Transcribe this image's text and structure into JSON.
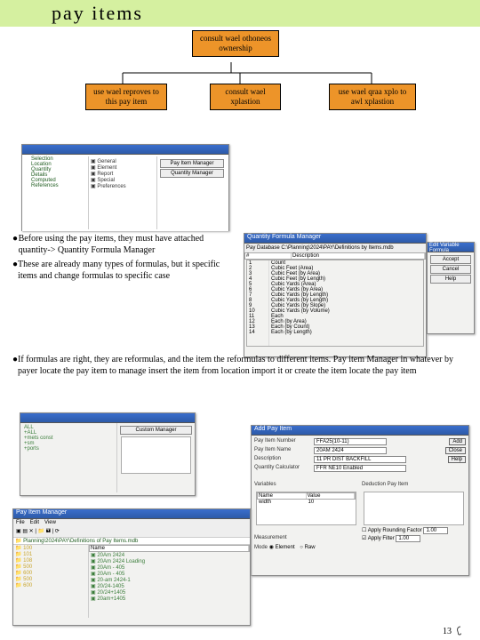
{
  "title": "pay items",
  "org": {
    "top": "consult wael othoneos ownership",
    "l": "use wael reproves to this pay item",
    "m": "consult wael xplastion",
    "r": "use wael qraa xplo to awl xplastion"
  },
  "bullets": [
    "Before using the pay items, they must have attached quantity-> Quantity Formula Manager",
    "These are already many types of formulas, but it specific items and change formulas to specific case",
    "If formulas are right, they are reformulas, and the item the reformulas to different items. Pay item Manager in whatever by payer locate the pay item to manage insert the item from location import it or create the item locate the pay item"
  ],
  "shots": {
    "a_tree": [
      "Selection",
      "Location",
      "Quantity",
      "Details",
      "Computed",
      "References"
    ],
    "a_btns": [
      "Pay Item Manager",
      "Quantity Manager"
    ],
    "b_title": "Quantity Formula Manager",
    "b_path": "Pay Database   C:\\Planning\\2024\\PAY\\Definitions by Items.mdb",
    "b_list": [
      "1",
      "2",
      "3",
      "4",
      "5",
      "6",
      "7",
      "8",
      "9",
      "10",
      "11",
      "12",
      "13",
      "14"
    ],
    "b_desc": [
      "Count",
      "Cubic Feet (Area)",
      "Cubic Feet (by Area)",
      "Cubic Feet (by Length)",
      "Cubic Yards (Area)",
      "Cubic Yards (by Area)",
      "Cubic Yards (by Length)",
      "Cubic Yards (by Length)",
      "Cubic Yards (by Slope)",
      "Cubic Yards (by Volume)",
      "Each",
      "Each (by Area)",
      "Each (by Count)",
      "Each (by Length)"
    ],
    "c_title": "Edit Variable Formula",
    "c_btns": [
      "Accept",
      "Cancel",
      "Help"
    ],
    "d_items": [
      "ALL",
      "+ALL",
      "+mets const",
      "+sm",
      "+ports"
    ],
    "d_btn": "Custom Manager",
    "e_title": "Add Pay Item",
    "e_num_lbl": "Pay Item Number",
    "e_num": "FFA25(10-11)",
    "e_name_lbl": "Pay Item Name",
    "e_name": "20AM 2424",
    "e_desc_lbl": "Description",
    "e_desc": "11 PR DIST BACKFILL",
    "e_q_lbl": "Quantity Calculator",
    "e_q": "FFR NE10 Enabled",
    "e_var_lbl": "Variables",
    "e_n": "Name",
    "e_v": "Value",
    "e_nrow": "width",
    "e_vrow": "10",
    "e_meas_lbl": "Measurement",
    "e_mode_lbl": "Mode",
    "e_radio1": "Element",
    "e_radio2": "Raw",
    "e_dp_lbl": "Deduction Pay Item",
    "e_ah": "Apply Rounding Factor",
    "e_ahv": "1.00",
    "e_af": "Apply Filter",
    "e_afv": "1.00",
    "e_add": "Add",
    "e_close": "Close",
    "e_help": "Help",
    "f_title": "Pay Item Manager",
    "f_menu": [
      "File",
      "Edit",
      "View"
    ],
    "f_path": "Planning\\2024\\PAY\\Definitions of Pay Items.mdb",
    "f_cols": [
      "Name"
    ],
    "f_folders": [
      "100",
      "101",
      "108",
      "500",
      "600",
      "500",
      "600"
    ],
    "f_items": [
      "20Am 2424",
      "20Am 2424 Loading",
      "20Am - 405",
      "20Am - 405",
      "20-am 2424-1",
      "20/24-1405",
      "20/24+1405",
      "20am+1405"
    ]
  },
  "pagenum": "13"
}
